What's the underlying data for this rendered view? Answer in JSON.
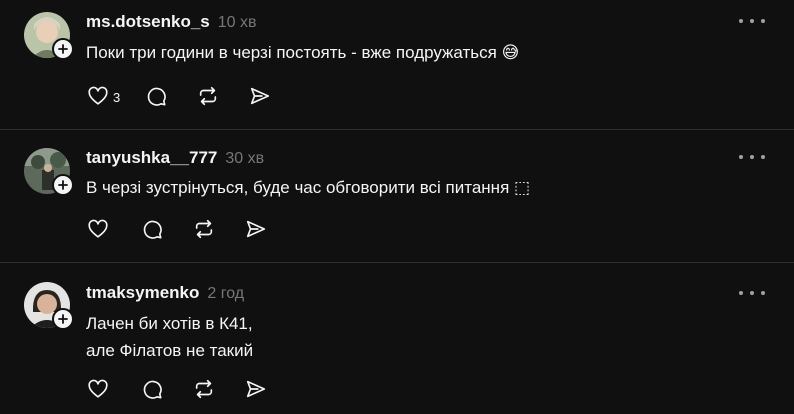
{
  "posts": [
    {
      "username": "ms.dotsenko_s",
      "time": "10 хв",
      "lines": [
        "Поки три години в черзі постоять - вже подружаться 😅"
      ],
      "like_count": "3"
    },
    {
      "username": "tanyushka__777",
      "time": "30 хв",
      "lines": [
        "В черзі зустрінуться, буде час обговорити всі питання ⬚"
      ],
      "like_count": ""
    },
    {
      "username": "tmaksymenko",
      "time": "2 год",
      "lines": [
        "Лачен би хотів в К41,",
        "але Філатов не такий"
      ],
      "like_count": ""
    }
  ],
  "icons": {
    "like": "heart-icon",
    "comment": "comment-icon",
    "repost": "repost-icon",
    "share": "share-icon",
    "more": "more-options-icon",
    "follow": "plus-icon"
  },
  "colors": {
    "background": "#101010",
    "text": "#f3f5f7",
    "muted": "#777777",
    "divider": "#2d2d2d"
  }
}
